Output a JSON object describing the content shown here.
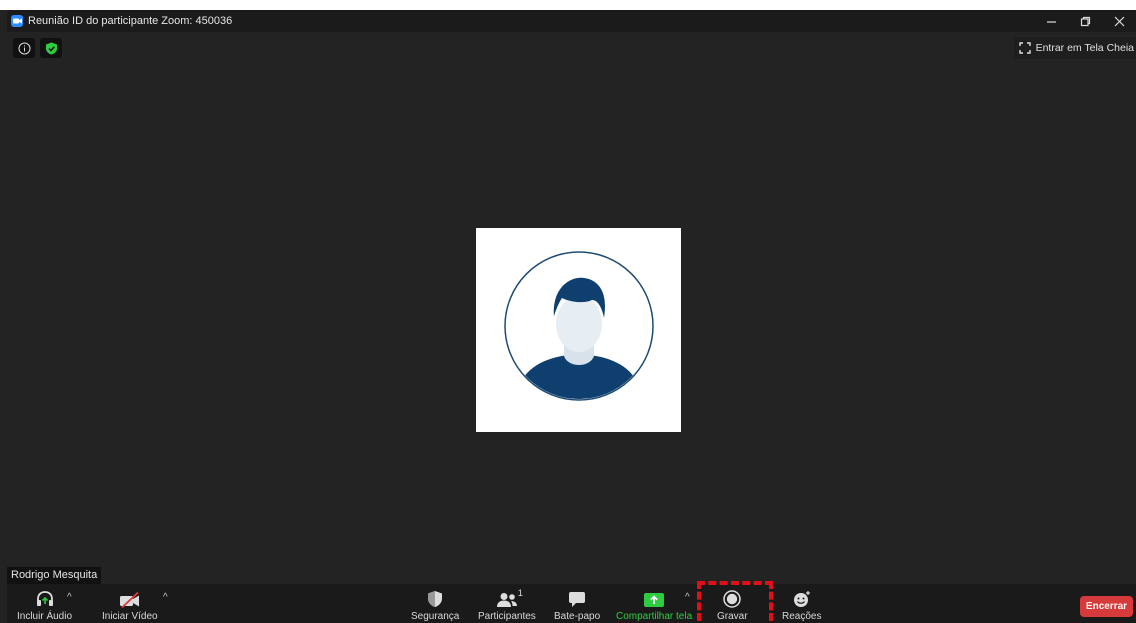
{
  "window": {
    "title": "Reunião ID do participante Zoom: 450036",
    "app_icon": "zoom-icon",
    "controls": [
      "minimize-icon",
      "restore-icon",
      "close-icon"
    ]
  },
  "top_bar": {
    "info_icon": "info-icon",
    "security_icon": "shield-check-icon",
    "fullscreen_label": "Entrar em Tela Cheia"
  },
  "participant": {
    "name": "Rodrigo Mesquita",
    "avatar_icon": "default-avatar"
  },
  "toolbar": {
    "audio_label": "Incluir Áudio",
    "video_label": "Iniciar Vídeo",
    "security_label": "Segurança",
    "participants_label": "Participantes",
    "participants_count": "1",
    "chat_label": "Bate-papo",
    "share_label": "Compartilhar tela",
    "record_label": "Gravar",
    "reactions_label": "Reações",
    "end_label": "Encerrar"
  },
  "colors": {
    "background": "#232323",
    "share_green": "#2ecc40",
    "end_red": "#d63a3a",
    "highlight_red": "#e0101a",
    "avatar_blue": "#0f3f6e"
  }
}
